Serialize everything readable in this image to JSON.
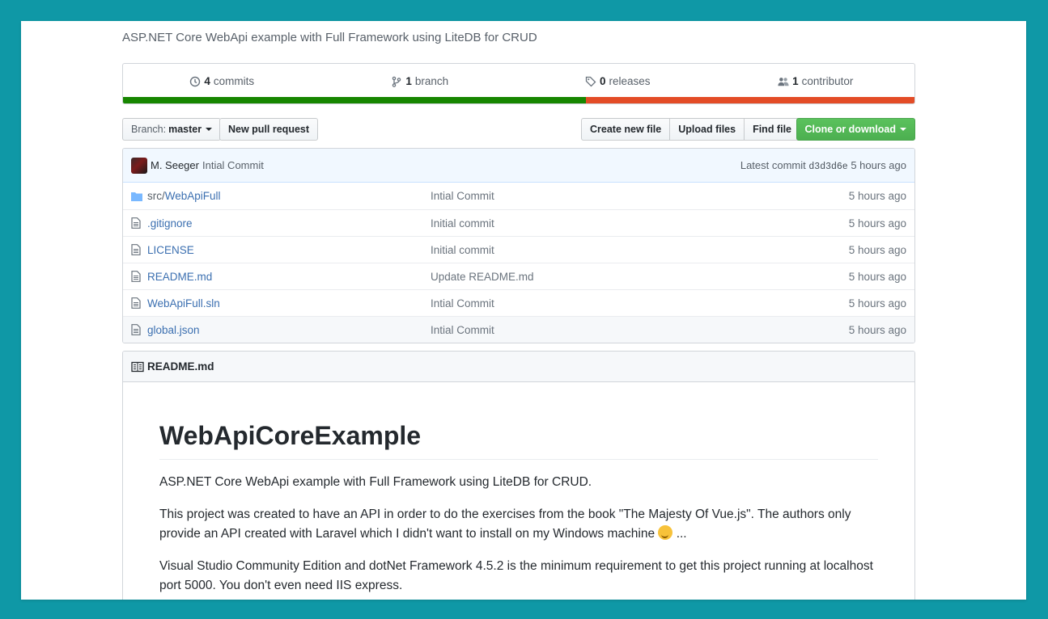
{
  "repo": {
    "description": "ASP.NET Core WebApi example with Full Framework using LiteDB for CRUD"
  },
  "summary": {
    "commits": {
      "count": "4",
      "label": "commits",
      "icon": "history-icon"
    },
    "branch": {
      "count": "1",
      "label": "branch",
      "icon": "branch-icon"
    },
    "releases": {
      "count": "0",
      "label": "releases",
      "icon": "tag-icon"
    },
    "contributor": {
      "count": "1",
      "label": "contributor",
      "icon": "people-icon"
    },
    "languages": [
      {
        "color": "#178600",
        "share": 0.585
      },
      {
        "color": "#e34c26",
        "share": 0.415
      }
    ]
  },
  "toolbar": {
    "branch_prefix": "Branch:",
    "branch_name": "master",
    "new_pr": "New pull request",
    "create_file": "Create new file",
    "upload_files": "Upload files",
    "find_file": "Find file",
    "clone": "Clone or download"
  },
  "latest_commit": {
    "author": "M. Seeger",
    "message": "Intial Commit",
    "label": "Latest commit",
    "sha": "d3d3d6e",
    "age": "5 hours ago"
  },
  "files": [
    {
      "prefix": "src/",
      "name": "WebApiFull",
      "type": "folder",
      "message": "Intial Commit",
      "age": "5 hours ago"
    },
    {
      "prefix": "",
      "name": ".gitignore",
      "type": "file",
      "message": "Initial commit",
      "age": "5 hours ago"
    },
    {
      "prefix": "",
      "name": "LICENSE",
      "type": "file",
      "message": "Initial commit",
      "age": "5 hours ago"
    },
    {
      "prefix": "",
      "name": "README.md",
      "type": "file",
      "message": "Update README.md",
      "age": "5 hours ago"
    },
    {
      "prefix": "",
      "name": "WebApiFull.sln",
      "type": "file",
      "message": "Intial Commit",
      "age": "5 hours ago"
    },
    {
      "prefix": "",
      "name": "global.json",
      "type": "file",
      "message": "Intial Commit",
      "age": "5 hours ago"
    }
  ],
  "readme": {
    "filename": "README.md",
    "heading": "WebApiCoreExample",
    "p1": "ASP.NET Core WebApi example with Full Framework using LiteDB for CRUD.",
    "p2": "This project was created to have an API in order to do the exercises from the book \"The Majesty Of Vue.js\". The authors only provide an API created with Laravel which I didn't want to install on my Windows machine",
    "p2_tail": " ...",
    "p3": "Visual Studio Community Edition and dotNet Framework 4.5.2 is the minimum requirement to get this project running at localhost port 5000. You don't even need IIS express."
  }
}
